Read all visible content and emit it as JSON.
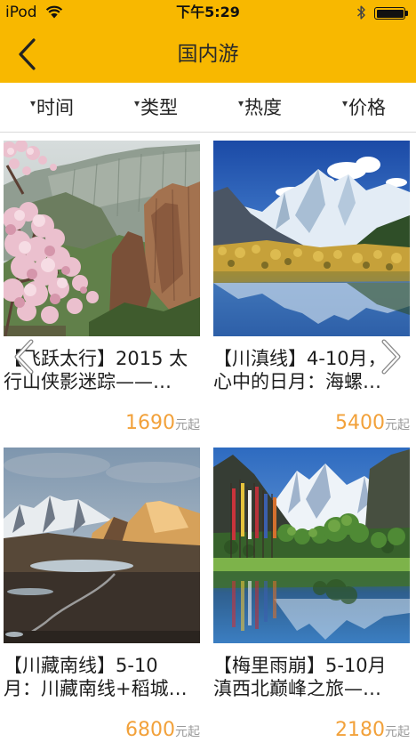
{
  "status_bar": {
    "device": "iPod",
    "time": "下午5:29",
    "battery_level_percent": 100,
    "icons": [
      "wifi-icon",
      "bluetooth-icon",
      "battery-icon"
    ]
  },
  "nav": {
    "title": "国内游",
    "back_icon": "chevron-left-icon"
  },
  "filters": [
    {
      "caret": "▾",
      "label": "时间"
    },
    {
      "caret": "▾",
      "label": "类型"
    },
    {
      "caret": "▾",
      "label": "热度"
    },
    {
      "caret": "▾",
      "label": "价格"
    }
  ],
  "tours": [
    {
      "title_lines": [
        "【飞跃太行】2015 太",
        "行山侠影迷踪——…"
      ],
      "price": "1690",
      "price_unit": "元起"
    },
    {
      "title_lines": [
        "【川滇线】4-10月，",
        "心中的日月：海螺…"
      ],
      "price": "5400",
      "price_unit": "元起"
    },
    {
      "title_lines": [
        "【川藏南线】5-10",
        "月：川藏南线+稻城…"
      ],
      "price": "6800",
      "price_unit": "元起"
    },
    {
      "title_lines": [
        "【梅里雨崩】5-10月",
        "滇西北巅峰之旅—…"
      ],
      "price": "2180",
      "price_unit": "元起"
    }
  ],
  "carousel": {
    "prev_icon": "chevron-left-icon",
    "next_icon": "chevron-right-icon"
  },
  "colors": {
    "accent": "#F8B800",
    "price": "#F2A13A",
    "price_unit": "#9A9A9A",
    "title": "#1E1E1E"
  }
}
